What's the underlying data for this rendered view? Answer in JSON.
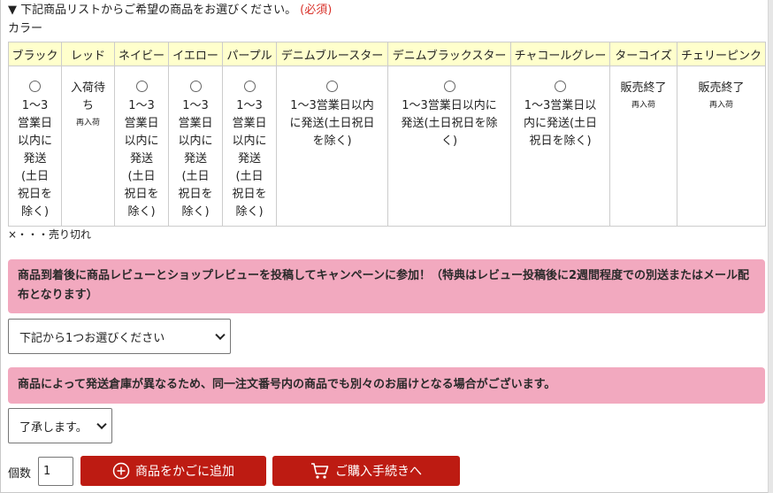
{
  "heading": {
    "text": "▼ 下記商品リストからご希望の商品をお選びください。",
    "required": "(必須)"
  },
  "color_label": "カラー",
  "colors": [
    {
      "name": "ブラック",
      "status": "1～3\n営業日\n以内に\n発送\n(土日\n祝日を\n除く)",
      "selectable": true,
      "sub": ""
    },
    {
      "name": "レッド",
      "status": "入荷待\nち",
      "selectable": false,
      "sub": "再入荷"
    },
    {
      "name": "ネイビー",
      "status": "1～3\n営業日\n以内に\n発送\n(土日\n祝日を\n除く)",
      "selectable": true,
      "sub": ""
    },
    {
      "name": "イエロー",
      "status": "1～3\n営業日\n以内に\n発送\n(土日\n祝日を\n除く)",
      "selectable": true,
      "sub": ""
    },
    {
      "name": "パープル",
      "status": "1～3\n営業日\n以内に\n発送\n(土日\n祝日を\n除く)",
      "selectable": true,
      "sub": ""
    },
    {
      "name": "デニムブルースター",
      "status": "1～3営業日以内\nに発送(土日祝日\nを除く)",
      "selectable": true,
      "sub": ""
    },
    {
      "name": "デニムブラックスター",
      "status": "1～3営業日以内に\n発送(土日祝日を除\nく)",
      "selectable": true,
      "sub": ""
    },
    {
      "name": "チャコールグレー",
      "status": "1～3営業日以\n内に発送(土日\n祝日を除く)",
      "selectable": true,
      "sub": ""
    },
    {
      "name": "ターコイズ",
      "status": "販売終了",
      "selectable": false,
      "sub": "再入荷"
    },
    {
      "name": "チェリーピンク",
      "status": "販売終了",
      "selectable": false,
      "sub": "再入荷"
    }
  ],
  "soldout_note": "×・・・売り切れ",
  "banner1": "商品到着後に商品レビューとショップレビューを投稿してキャンペーンに参加！（特典はレビュー投稿後に2週間程度での別送またはメール配布となります）",
  "review_select": {
    "value": "下記から1つお選びください"
  },
  "banner2": "商品によって発送倉庫が異なるため、同一注文番号内の商品でも別々のお届けとなる場合がございます。",
  "consent_select": {
    "value": "了承します。"
  },
  "quantity": {
    "label": "個数",
    "value": "1"
  },
  "buttons": {
    "add_to_cart": "商品をかごに追加",
    "checkout": "ご購入手続きへ"
  },
  "theme": {
    "accent": "#bd1b12",
    "banner": "#f2a9bf",
    "header_bg": "#ffffcc",
    "required": "#d9322a"
  },
  "icons": {
    "add": "plus-circle-icon",
    "cart": "cart-icon"
  }
}
